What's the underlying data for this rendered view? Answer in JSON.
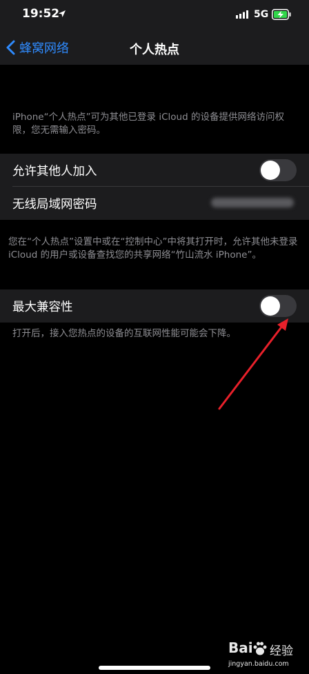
{
  "status": {
    "time": "19:52",
    "network": "5G"
  },
  "nav": {
    "back_label": "蜂窝网络",
    "title": "个人热点"
  },
  "intro_text": "iPhone“个人热点”可为其他已登录 iCloud 的设备提供网络访问权限，您无需输入密码。",
  "rows": {
    "allow_others": {
      "label": "允许其他人加入",
      "enabled": false
    },
    "wifi_password": {
      "label": "无线局域网密码"
    },
    "max_compat": {
      "label": "最大兼容性",
      "enabled": false
    }
  },
  "discovery_text": "您在“个人热点”设置中或在“控制中心”中将其打开时，允许其他未登录 iCloud 的用户或设备查找您的共享网络“竹山流水 iPhone”。",
  "compat_text": "打开后，接入您热点的设备的互联网性能可能会下降。",
  "watermark": {
    "logo_text": "Bai",
    "brand": "经验",
    "url": "jingyan.baidu.com"
  },
  "colors": {
    "accent": "#2f8bff",
    "annotation_arrow": "#e8202a",
    "toggle_off": "#39393d"
  }
}
